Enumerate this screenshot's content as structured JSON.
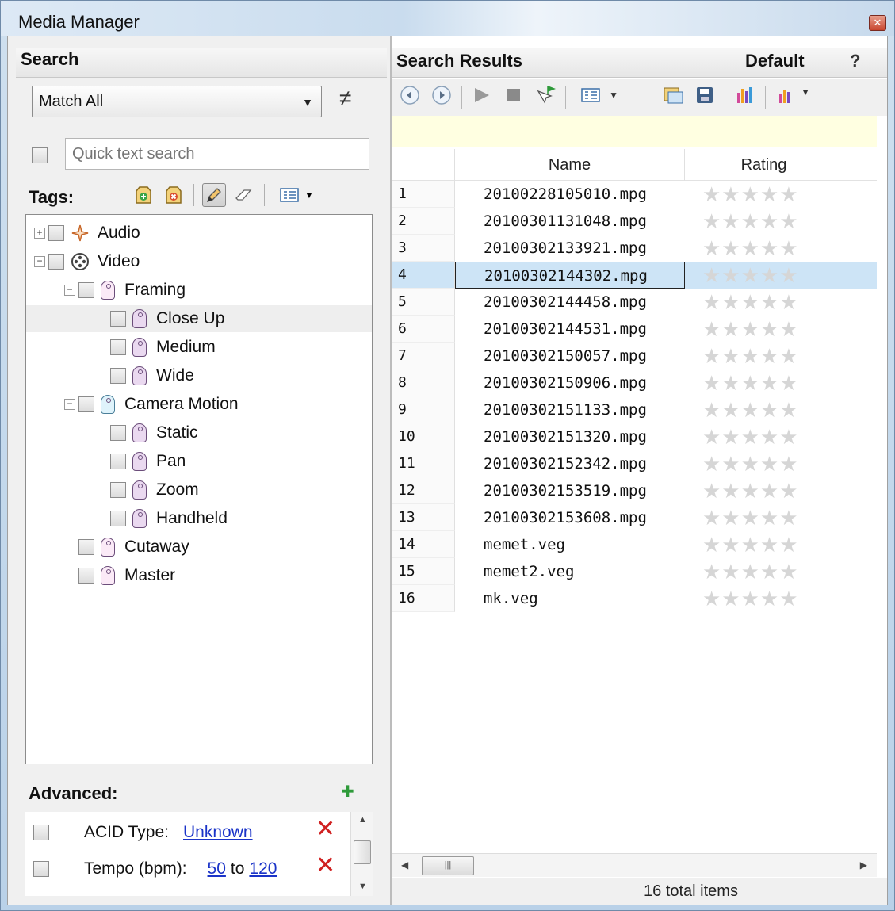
{
  "window": {
    "title": "Media Manager",
    "close_icon": "close-icon"
  },
  "search_pane": {
    "header": "Search",
    "match_combo": "Match All",
    "not_equal_symbol": "≠",
    "quick_search_placeholder": "Quick text search",
    "tags_label": "Tags:",
    "tag_toolbar_icons": [
      "add-tag-icon",
      "remove-tag-icon",
      "pencil-icon",
      "eraser-icon",
      "view-options-icon"
    ],
    "tree": [
      {
        "label": "Audio",
        "level": 0,
        "expander": "+",
        "icon": "audio-icon"
      },
      {
        "label": "Video",
        "level": 0,
        "expander": "−",
        "icon": "video-reel-icon"
      },
      {
        "label": "Framing",
        "level": 1,
        "expander": "−",
        "icon": "tag-icon"
      },
      {
        "label": "Close Up",
        "level": 2,
        "icon": "tag-icon",
        "selected": true
      },
      {
        "label": "Medium",
        "level": 2,
        "icon": "tag-icon"
      },
      {
        "label": "Wide",
        "level": 2,
        "icon": "tag-icon"
      },
      {
        "label": "Camera Motion",
        "level": 1,
        "expander": "−",
        "icon": "tag-icon"
      },
      {
        "label": "Static",
        "level": 2,
        "icon": "tag-icon"
      },
      {
        "label": "Pan",
        "level": 2,
        "icon": "tag-icon"
      },
      {
        "label": "Zoom",
        "level": 2,
        "icon": "tag-icon"
      },
      {
        "label": "Handheld",
        "level": 2,
        "icon": "tag-icon"
      },
      {
        "label": "Cutaway",
        "level": 1,
        "icon": "tag-icon"
      },
      {
        "label": "Master",
        "level": 1,
        "icon": "tag-icon"
      }
    ],
    "advanced": {
      "label": "Advanced:",
      "rows": [
        {
          "label": "ACID Type:",
          "value": "Unknown"
        },
        {
          "label": "Tempo (bpm):",
          "from": "50",
          "to_word": "to",
          "to": "120"
        }
      ]
    }
  },
  "results_pane": {
    "header": "Search Results",
    "preset": "Default",
    "help": "?",
    "toolbar_icons": [
      "back-icon",
      "forward-icon",
      "play-icon",
      "stop-icon",
      "auto-preview-icon",
      "view-icon",
      "add-to-project-icon",
      "save-icon",
      "chart-icon",
      "chart-options-icon"
    ],
    "columns": [
      "Name",
      "Rating"
    ],
    "rows": [
      {
        "num": "1",
        "name": "20100228105010.mpg"
      },
      {
        "num": "2",
        "name": "20100301131048.mpg"
      },
      {
        "num": "3",
        "name": "20100302133921.mpg"
      },
      {
        "num": "4",
        "name": "20100302144302.mpg",
        "selected": true
      },
      {
        "num": "5",
        "name": "20100302144458.mpg"
      },
      {
        "num": "6",
        "name": "20100302144531.mpg"
      },
      {
        "num": "7",
        "name": "20100302150057.mpg"
      },
      {
        "num": "8",
        "name": "20100302150906.mpg"
      },
      {
        "num": "9",
        "name": "20100302151133.mpg"
      },
      {
        "num": "10",
        "name": "20100302151320.mpg"
      },
      {
        "num": "11",
        "name": "20100302152342.mpg"
      },
      {
        "num": "12",
        "name": "20100302153519.mpg"
      },
      {
        "num": "13",
        "name": "20100302153608.mpg"
      },
      {
        "num": "14",
        "name": "memet.veg"
      },
      {
        "num": "15",
        "name": "memet2.veg"
      },
      {
        "num": "16",
        "name": "mk.veg"
      }
    ],
    "rating_stars": "★★★★★",
    "status": "16 total items"
  }
}
